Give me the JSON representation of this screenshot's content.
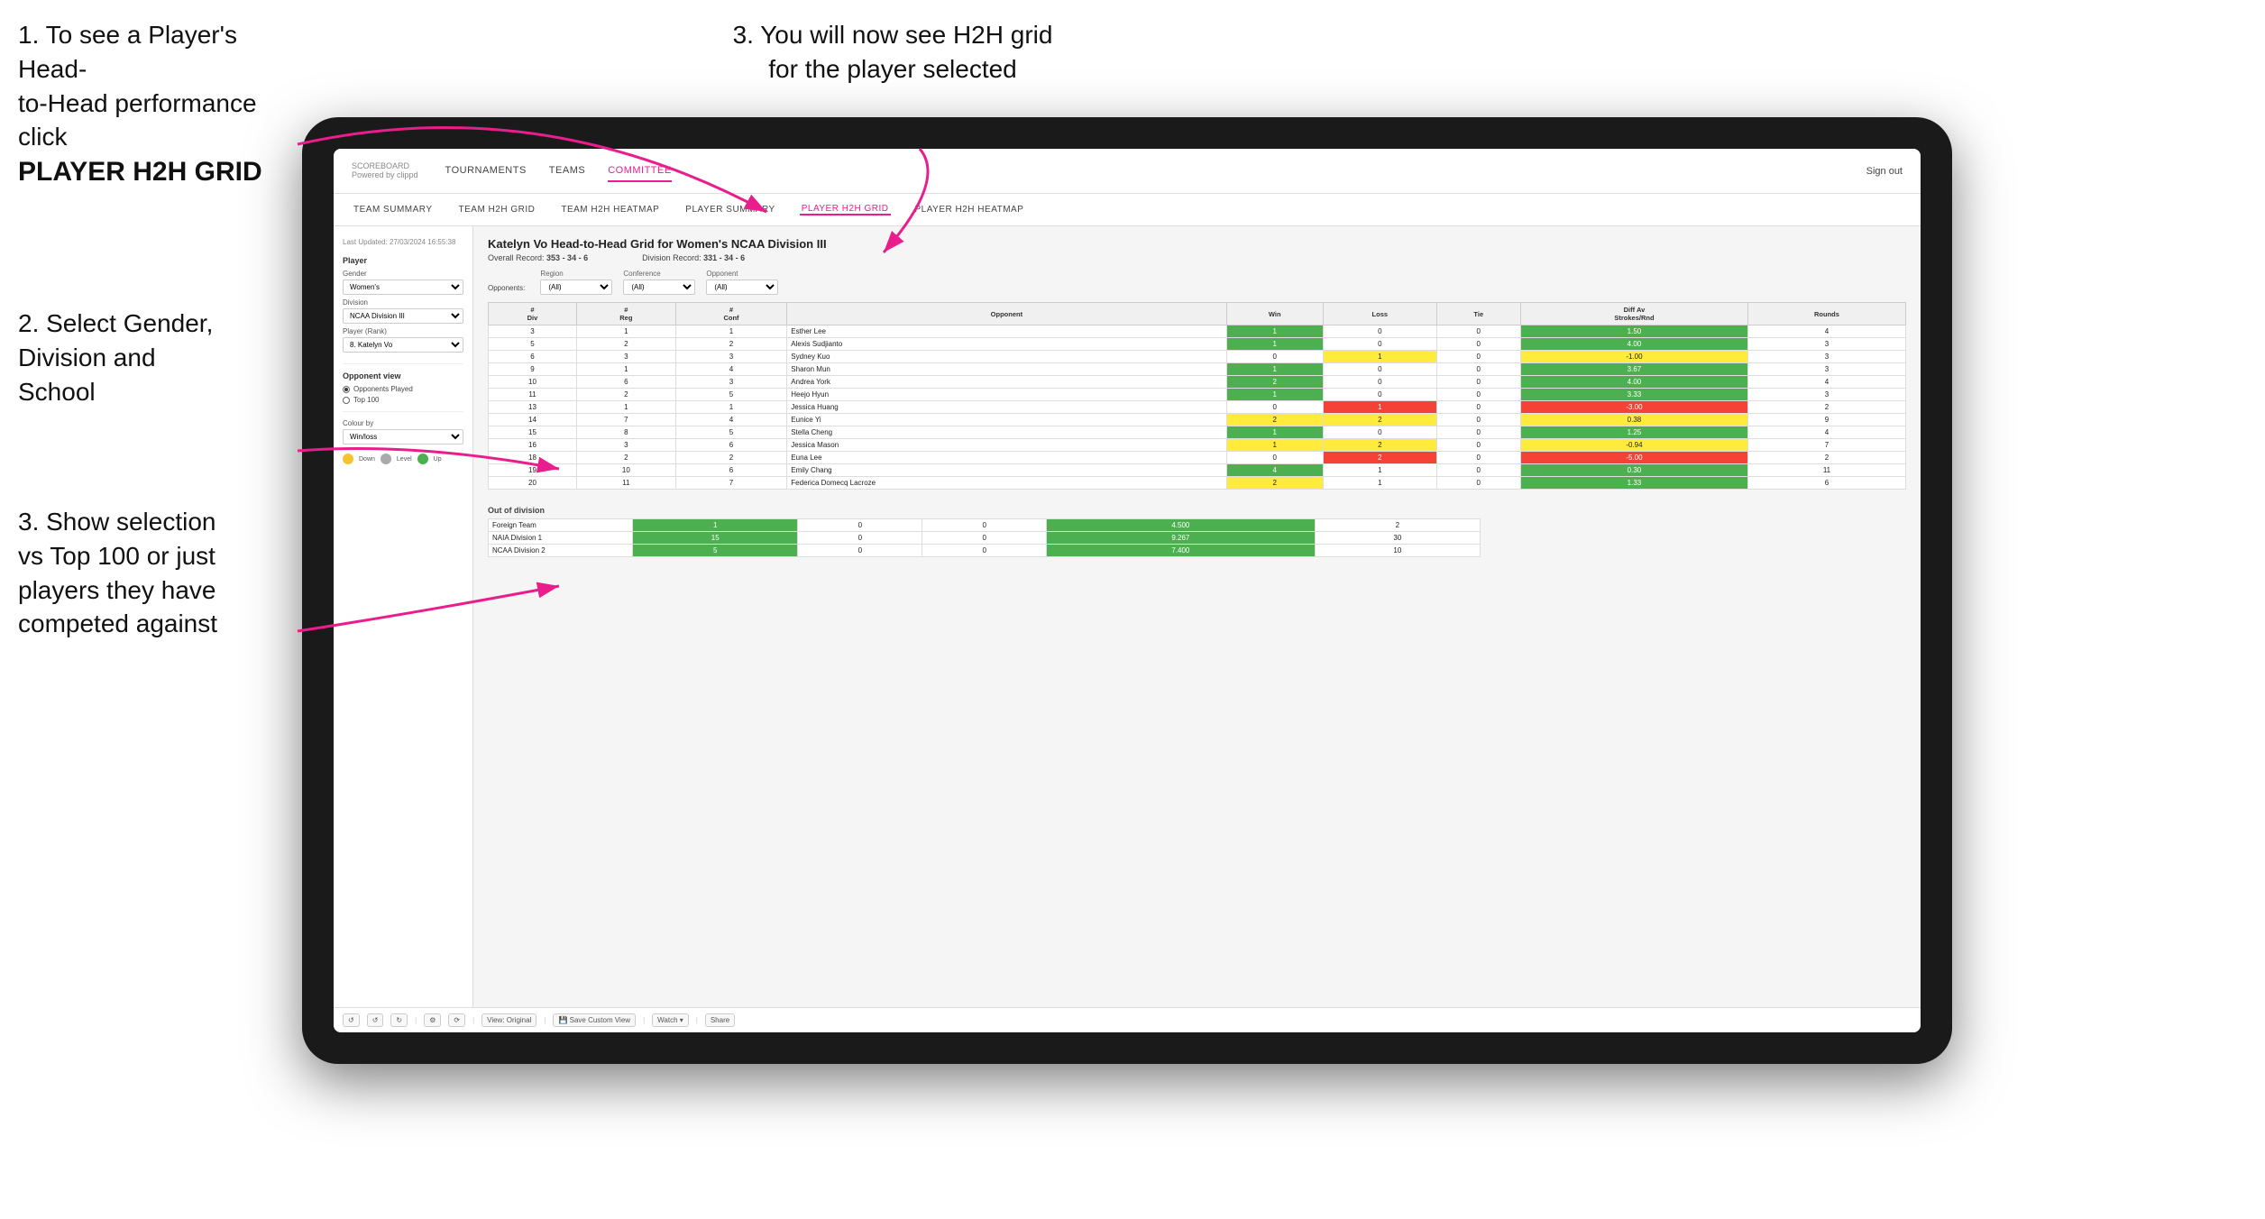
{
  "instructions": {
    "top_left_line1": "1. To see a Player's Head-",
    "top_left_line2": "to-Head performance click",
    "top_left_bold": "PLAYER H2H GRID",
    "top_right": "3. You will now see H2H grid\nfor the player selected",
    "mid_left_line1": "2. Select Gender,",
    "mid_left_line2": "Division and",
    "mid_left_line3": "School",
    "bottom_left_line1": "3. Show selection",
    "bottom_left_line2": "vs Top 100 or just",
    "bottom_left_line3": "players they have",
    "bottom_left_line4": "competed against"
  },
  "nav": {
    "logo": "SCOREBOARD",
    "logo_sub": "Powered by clippd",
    "links": [
      "TOURNAMENTS",
      "TEAMS",
      "COMMITTEE"
    ],
    "active_link": "COMMITTEE",
    "sign_out": "Sign out"
  },
  "sub_nav": {
    "links": [
      "TEAM SUMMARY",
      "TEAM H2H GRID",
      "TEAM H2H HEATMAP",
      "PLAYER SUMMARY",
      "PLAYER H2H GRID",
      "PLAYER H2H HEATMAP"
    ],
    "active": "PLAYER H2H GRID"
  },
  "sidebar": {
    "timestamp": "Last Updated: 27/03/2024\n16:55:38",
    "player_section": "Player",
    "gender_label": "Gender",
    "gender_value": "Women's",
    "division_label": "Division",
    "division_value": "NCAA Division III",
    "player_rank_label": "Player (Rank)",
    "player_rank_value": "8. Katelyn Vo",
    "opponent_view_label": "Opponent view",
    "radio_1": "Opponents Played",
    "radio_2": "Top 100",
    "colour_by_label": "Colour by",
    "colour_by_value": "Win/loss",
    "legend_down": "Down",
    "legend_level": "Level",
    "legend_up": "Up"
  },
  "grid": {
    "title": "Katelyn Vo Head-to-Head Grid for Women's NCAA Division III",
    "overall_record_label": "Overall Record:",
    "overall_record": "353 - 34 - 6",
    "division_record_label": "Division Record:",
    "division_record": "331 - 34 - 6",
    "region_label": "Region",
    "conference_label": "Conference",
    "opponent_label": "Opponent",
    "opponents_label": "Opponents:",
    "filter_all": "(All)",
    "columns": [
      "#\nDiv",
      "#\nReg",
      "#\nConf",
      "Opponent",
      "Win",
      "Loss",
      "Tie",
      "Diff Av\nStrokes/Rnd",
      "Rounds"
    ],
    "rows": [
      {
        "div": 3,
        "reg": 1,
        "conf": 1,
        "opponent": "Esther Lee",
        "win": 1,
        "loss": 0,
        "tie": 0,
        "diff": 1.5,
        "rounds": 4,
        "win_color": "green",
        "loss_color": "",
        "diff_color": "green"
      },
      {
        "div": 5,
        "reg": 2,
        "conf": 2,
        "opponent": "Alexis Sudjianto",
        "win": 1,
        "loss": 0,
        "tie": 0,
        "diff": 4.0,
        "rounds": 3,
        "win_color": "green",
        "loss_color": "",
        "diff_color": "green"
      },
      {
        "div": 6,
        "reg": 3,
        "conf": 3,
        "opponent": "Sydney Kuo",
        "win": 0,
        "loss": 1,
        "tie": 0,
        "diff": -1.0,
        "rounds": 3,
        "win_color": "",
        "loss_color": "yellow",
        "diff_color": "yellow"
      },
      {
        "div": 9,
        "reg": 1,
        "conf": 4,
        "opponent": "Sharon Mun",
        "win": 1,
        "loss": 0,
        "tie": 0,
        "diff": 3.67,
        "rounds": 3,
        "win_color": "green",
        "loss_color": "",
        "diff_color": "green"
      },
      {
        "div": 10,
        "reg": 6,
        "conf": 3,
        "opponent": "Andrea York",
        "win": 2,
        "loss": 0,
        "tie": 0,
        "diff": 4.0,
        "rounds": 4,
        "win_color": "green",
        "loss_color": "",
        "diff_color": "green"
      },
      {
        "div": 11,
        "reg": 2,
        "conf": 5,
        "opponent": "Heejo Hyun",
        "win": 1,
        "loss": 0,
        "tie": 0,
        "diff": 3.33,
        "rounds": 3,
        "win_color": "green",
        "loss_color": "",
        "diff_color": "green"
      },
      {
        "div": 13,
        "reg": 1,
        "conf": 1,
        "opponent": "Jessica Huang",
        "win": 0,
        "loss": 1,
        "tie": 0,
        "diff": -3.0,
        "rounds": 2,
        "win_color": "",
        "loss_color": "red",
        "diff_color": "red"
      },
      {
        "div": 14,
        "reg": 7,
        "conf": 4,
        "opponent": "Eunice Yi",
        "win": 2,
        "loss": 2,
        "tie": 0,
        "diff": 0.38,
        "rounds": 9,
        "win_color": "yellow",
        "loss_color": "yellow",
        "diff_color": "yellow"
      },
      {
        "div": 15,
        "reg": 8,
        "conf": 5,
        "opponent": "Stella Cheng",
        "win": 1,
        "loss": 0,
        "tie": 0,
        "diff": 1.25,
        "rounds": 4,
        "win_color": "green",
        "loss_color": "",
        "diff_color": "green"
      },
      {
        "div": 16,
        "reg": 3,
        "conf": 6,
        "opponent": "Jessica Mason",
        "win": 1,
        "loss": 2,
        "tie": 0,
        "diff": -0.94,
        "rounds": 7,
        "win_color": "yellow",
        "loss_color": "yellow",
        "diff_color": "yellow"
      },
      {
        "div": 18,
        "reg": 2,
        "conf": 2,
        "opponent": "Euna Lee",
        "win": 0,
        "loss": 2,
        "tie": 0,
        "diff": -5.0,
        "rounds": 2,
        "win_color": "",
        "loss_color": "red",
        "diff_color": "red"
      },
      {
        "div": 19,
        "reg": 10,
        "conf": 6,
        "opponent": "Emily Chang",
        "win": 4,
        "loss": 1,
        "tie": 0,
        "diff": 0.3,
        "rounds": 11,
        "win_color": "green",
        "loss_color": "",
        "diff_color": "green"
      },
      {
        "div": 20,
        "reg": 11,
        "conf": 7,
        "opponent": "Federica Domecq Lacroze",
        "win": 2,
        "loss": 1,
        "tie": 0,
        "diff": 1.33,
        "rounds": 6,
        "win_color": "yellow",
        "loss_color": "",
        "diff_color": "green"
      }
    ],
    "out_of_division_label": "Out of division",
    "out_of_division_rows": [
      {
        "label": "Foreign Team",
        "win": 1,
        "loss": 0,
        "tie": 0,
        "diff": 4.5,
        "rounds": 2
      },
      {
        "label": "NAIA Division 1",
        "win": 15,
        "loss": 0,
        "tie": 0,
        "diff": 9.267,
        "rounds": 30
      },
      {
        "label": "NCAA Division 2",
        "win": 5,
        "loss": 0,
        "tie": 0,
        "diff": 7.4,
        "rounds": 10
      }
    ]
  },
  "toolbar": {
    "undo": "↺",
    "redo": "↻",
    "view_original": "View: Original",
    "save_custom": "Save Custom View",
    "watch": "Watch ▾",
    "share": "Share"
  }
}
